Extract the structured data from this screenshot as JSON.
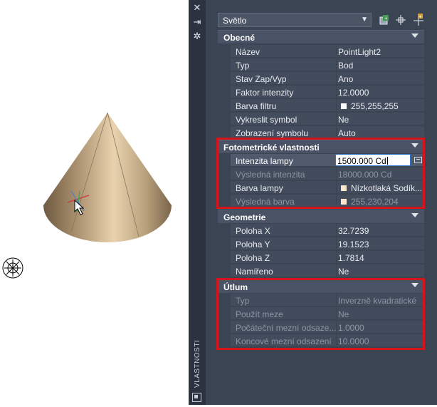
{
  "palette": {
    "vertical_title": "VLASTNOSTI",
    "selector": {
      "value": "Světlo"
    },
    "toolbar": [
      "quick-select-icon",
      "select-objects-icon",
      "toggle-pickadd-icon"
    ],
    "strip_icons": [
      "close-icon",
      "autohide-icon",
      "properties-menu-icon"
    ]
  },
  "categories": {
    "general": {
      "title": "Obecné",
      "rows": [
        {
          "name": "Název",
          "value": "PointLight2"
        },
        {
          "name": "Typ",
          "value": "Bod"
        },
        {
          "name": "Stav Zap/Vyp",
          "value": "Ano"
        },
        {
          "name": "Faktor intenzity",
          "value": "12.0000"
        },
        {
          "name": "Barva filtru",
          "value": "255,255,255",
          "swatch": "#ffffff"
        },
        {
          "name": "Vykreslit symbol",
          "value": "Ne"
        },
        {
          "name": "Zobrazení symbolu",
          "value": "Auto"
        }
      ]
    },
    "photometric": {
      "title": "Fotometrické vlastnosti",
      "rows": [
        {
          "name": "Intenzita lampy",
          "value": "1500.000 Cd"
        },
        {
          "name": "Výsledná intenzita",
          "value": "18000.000 Cd"
        },
        {
          "name": "Barva lampy",
          "value": "Nízkotlaká  Sodík...",
          "swatch": "#f6e6cc"
        },
        {
          "name": "Výsledná barva",
          "value": "255,230,204",
          "swatch": "#ffe6cc"
        }
      ]
    },
    "geometry": {
      "title": "Geometrie",
      "rows": [
        {
          "name": "Poloha X",
          "value": "32.7239"
        },
        {
          "name": "Poloha Y",
          "value": "19.1523"
        },
        {
          "name": "Poloha Z",
          "value": "1.7814"
        },
        {
          "name": "Namířeno",
          "value": "Ne"
        }
      ]
    },
    "attenuation": {
      "title": "Útlum",
      "rows": [
        {
          "name": "Typ",
          "value": "Inverzně kvadratické"
        },
        {
          "name": "Použít meze",
          "value": "Ne"
        },
        {
          "name": "Počáteční mezní odsaze...",
          "value": "1.0000"
        },
        {
          "name": "Koncové mezní odsazení",
          "value": "10.0000"
        }
      ]
    }
  },
  "colors": {
    "highlight": "#d4151b",
    "cone": "#c9ad87",
    "palette_bg": "#3b4453"
  }
}
